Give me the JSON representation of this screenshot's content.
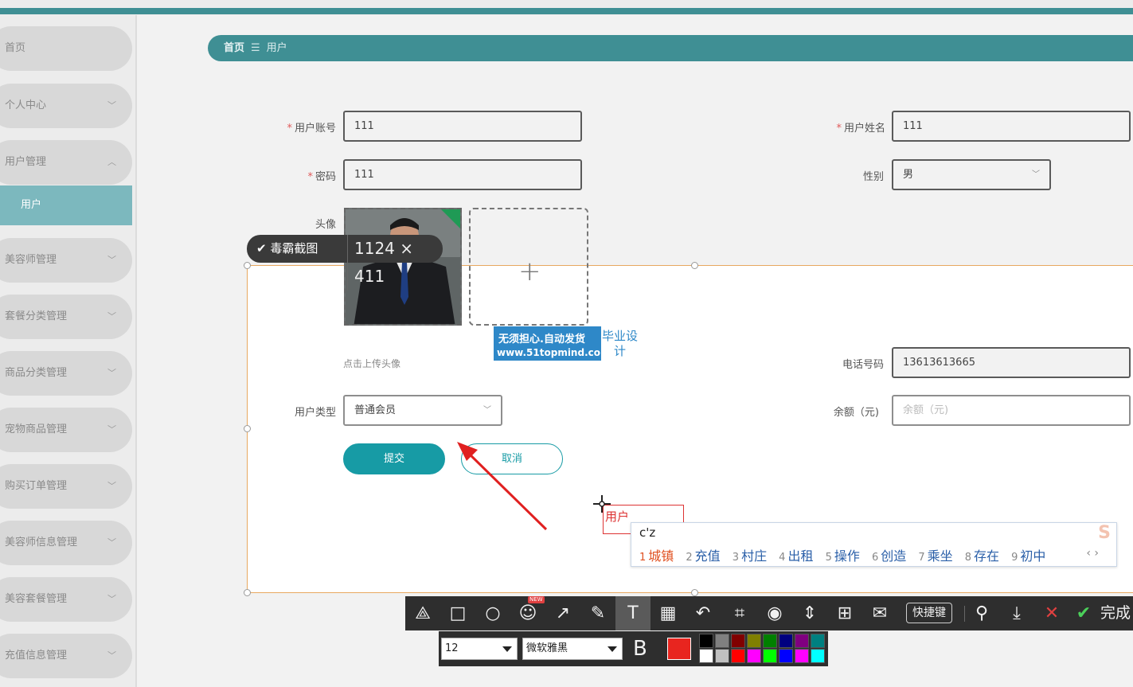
{
  "sidebar": {
    "items": [
      {
        "label": "首页",
        "chev": ""
      },
      {
        "label": "个人中心",
        "chev": "﹀"
      },
      {
        "label": "用户管理",
        "chev": "︿"
      },
      {
        "label": "美容师管理",
        "chev": "﹀"
      },
      {
        "label": "套餐分类管理",
        "chev": "﹀"
      },
      {
        "label": "商品分类管理",
        "chev": "﹀"
      },
      {
        "label": "宠物商品管理",
        "chev": "﹀"
      },
      {
        "label": "购买订单管理",
        "chev": "﹀"
      },
      {
        "label": "美容师信息管理",
        "chev": "﹀"
      },
      {
        "label": "美容套餐管理",
        "chev": "﹀"
      },
      {
        "label": "充值信息管理",
        "chev": "﹀"
      }
    ],
    "active_sub": "用户"
  },
  "breadcrumb": {
    "home": "首页",
    "sep": "☰",
    "current": "用户"
  },
  "form": {
    "account": {
      "label": "用户账号",
      "value": "111"
    },
    "name": {
      "label": "用户姓名",
      "value": "111"
    },
    "password": {
      "label": "密码",
      "value": "111"
    },
    "gender": {
      "label": "性别",
      "value": "男"
    },
    "avatar": {
      "label": "头像",
      "hint": "点击上传头像"
    },
    "phone": {
      "label": "电话号码",
      "value": "13613613665"
    },
    "user_type": {
      "label": "用户类型",
      "value": "普通会员"
    },
    "balance": {
      "label": "余额（元)",
      "placeholder": "余额（元)"
    },
    "submit_label": "提交",
    "cancel_label": "取消"
  },
  "capture": {
    "brand": "毒霸截图",
    "dimensions": "1124 × 411"
  },
  "watermark": {
    "line1": "无须担心.自动发货",
    "line2": "www.51topmind.com",
    "right": "毕业设计"
  },
  "annotation_text": "用户",
  "ime": {
    "input": "c'z",
    "candidates": [
      {
        "n": "1",
        "text": "城镇"
      },
      {
        "n": "2",
        "text": "充值"
      },
      {
        "n": "3",
        "text": "村庄"
      },
      {
        "n": "4",
        "text": "出租"
      },
      {
        "n": "5",
        "text": "操作"
      },
      {
        "n": "6",
        "text": "创造"
      },
      {
        "n": "7",
        "text": "乘坐"
      },
      {
        "n": "8",
        "text": "存在"
      },
      {
        "n": "9",
        "text": "初中"
      }
    ],
    "nav": "‹  ›"
  },
  "editor": {
    "shortcut_label": "快捷键",
    "new_badge": "NEW",
    "done_label": "完成",
    "font_size": "12",
    "font_family": "微软雅黑",
    "bold_label": "B",
    "current_color": "#e8251f",
    "palette_top": [
      "#000000",
      "#808080",
      "#800000",
      "#808000",
      "#008000",
      "#000080",
      "#800080",
      "#008080"
    ],
    "palette_bottom": [
      "#ffffff",
      "#c0c0c0",
      "#ff0000",
      "#ff00ff",
      "#00ff00",
      "#0000ff",
      "#ff00ff",
      "#00ffff"
    ]
  }
}
